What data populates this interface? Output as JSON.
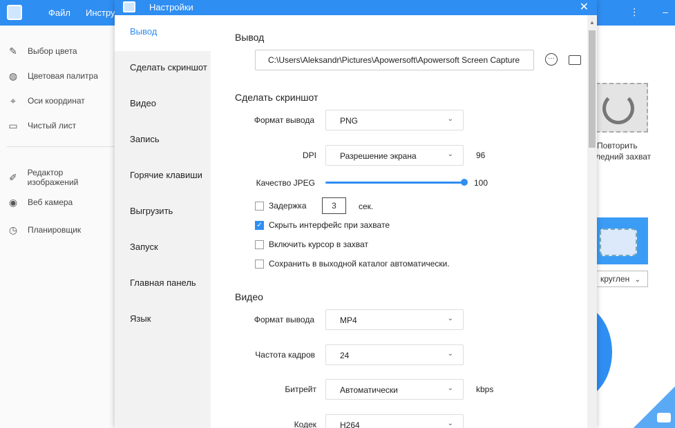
{
  "background_app": {
    "menu": [
      "Файл",
      "Инстру"
    ],
    "sidebar": [
      {
        "label": "Выбор цвета",
        "icon": "pen-icon"
      },
      {
        "label": "Цветовая палитра",
        "icon": "palette-icon"
      },
      {
        "label": "Оси координат",
        "icon": "crosshair-icon"
      },
      {
        "label": "Чистый лист",
        "icon": "monitor-icon"
      },
      {
        "label": "Редактор изображений",
        "icon": "edit-icon"
      },
      {
        "label": "Веб камера",
        "icon": "webcam-icon"
      },
      {
        "label": "Планировщик",
        "icon": "clock-icon"
      }
    ],
    "right_caption_1": "Повторить",
    "right_caption_2": "ледний захват",
    "right_select": "круглен"
  },
  "dialog": {
    "title": "Настройки",
    "nav": [
      "Вывод",
      "Сделать скриншот",
      "Видео",
      "Запись",
      "Горячие клавиши",
      "Выгрузить",
      "Запуск",
      "Главная панель",
      "Язык"
    ],
    "output": {
      "title": "Вывод",
      "path": "C:\\Users\\Aleksandr\\Pictures\\Apowersoft\\Apowersoft Screen Capture"
    },
    "screenshot": {
      "title": "Сделать скриншот",
      "format_label": "Формат вывода",
      "format_value": "PNG",
      "dpi_label": "DPI",
      "dpi_value": "Разрешение экрана",
      "dpi_number": "96",
      "quality_label": "Качество JPEG",
      "quality_value": "100",
      "delay_label": "Задержка",
      "delay_value": "3",
      "delay_unit": "сек.",
      "hide_ui": "Скрыть интерфейс при захвате",
      "include_cursor": "Включить курсор в захват",
      "autosave": "Сохранить в выходной каталог автоматически."
    },
    "video": {
      "title": "Видео",
      "format_label": "Формат вывода",
      "format_value": "MP4",
      "fps_label": "Частота кадров",
      "fps_value": "24",
      "bitrate_label": "Битрейт",
      "bitrate_value": "Автоматически",
      "bitrate_unit": "kbps",
      "codec_label": "Кодек",
      "codec_value": "H264"
    }
  }
}
